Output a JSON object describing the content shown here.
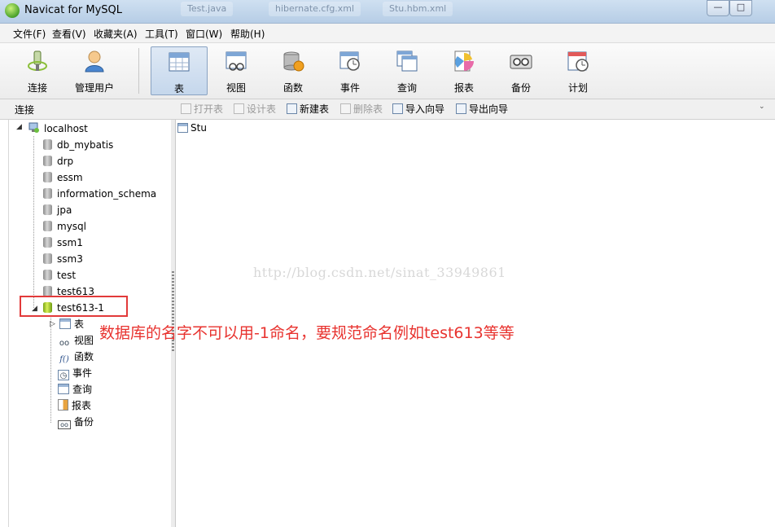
{
  "window": {
    "title": "Navicat for MySQL",
    "background_tabs": [
      "Test.java",
      "hibernate.cfg.xml",
      "Stu.hbm.xml"
    ],
    "controls": {
      "minimize": "—",
      "maximize": "□"
    }
  },
  "menu": [
    "文件(F)",
    "查看(V)",
    "收藏夹(A)",
    "工具(T)",
    "窗口(W)",
    "帮助(H)"
  ],
  "toolbar": [
    {
      "label": "连接",
      "icon": "connect-icon"
    },
    {
      "label": "管理用户",
      "icon": "user-icon"
    },
    {
      "label": "表",
      "icon": "table-icon",
      "active": true
    },
    {
      "label": "视图",
      "icon": "view-icon"
    },
    {
      "label": "函数",
      "icon": "function-icon"
    },
    {
      "label": "事件",
      "icon": "event-icon"
    },
    {
      "label": "查询",
      "icon": "query-icon"
    },
    {
      "label": "报表",
      "icon": "report-icon"
    },
    {
      "label": "备份",
      "icon": "backup-icon"
    },
    {
      "label": "计划",
      "icon": "schedule-icon"
    }
  ],
  "object_bar": {
    "section_label": "连接",
    "buttons": [
      {
        "label": "打开表",
        "enabled": false
      },
      {
        "label": "设计表",
        "enabled": false
      },
      {
        "label": "新建表",
        "enabled": true
      },
      {
        "label": "删除表",
        "enabled": false
      },
      {
        "label": "导入向导",
        "enabled": true
      },
      {
        "label": "导出向导",
        "enabled": true
      }
    ]
  },
  "tree": {
    "connection": "localhost",
    "databases": [
      "db_mybatis",
      "drp",
      "essm",
      "information_schema",
      "jpa",
      "mysql",
      "ssm1",
      "ssm3",
      "test",
      "test613",
      "test613-1"
    ],
    "open_database": "test613-1",
    "children": [
      {
        "label": "表",
        "icon": "table-icon"
      },
      {
        "label": "视图",
        "icon": "view-icon"
      },
      {
        "label": "函数",
        "icon": "function-icon"
      },
      {
        "label": "事件",
        "icon": "event-icon"
      },
      {
        "label": "查询",
        "icon": "query-icon"
      },
      {
        "label": "报表",
        "icon": "report-icon"
      },
      {
        "label": "备份",
        "icon": "backup-icon"
      }
    ]
  },
  "content": {
    "items": [
      "Stu"
    ],
    "watermark": "http://blog.csdn.net/sinat_33949861"
  },
  "annotation": {
    "text": "数据库的名字不可以用-1命名，要规范命名例如test613等等",
    "color": "#e8332f"
  }
}
